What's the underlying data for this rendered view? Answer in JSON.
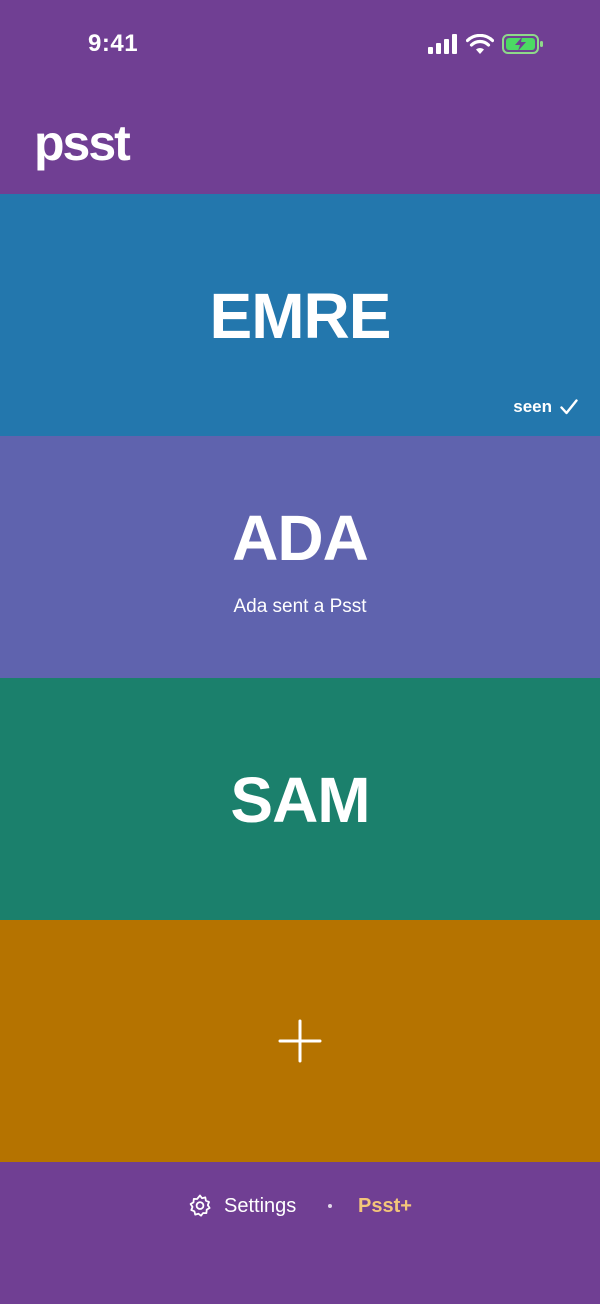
{
  "status_bar": {
    "time": "9:41",
    "icons": [
      "signal-icon",
      "wifi-icon",
      "battery-charging-icon"
    ]
  },
  "header": {
    "title": "psst"
  },
  "contacts": [
    {
      "name": "EMRE",
      "status": "seen",
      "color": "#2377ad"
    },
    {
      "name": "ADA",
      "subtitle": "Ada sent a Psst",
      "color": "#5f63ae"
    },
    {
      "name": "SAM",
      "color": "#1b806c"
    }
  ],
  "add_contact": {
    "icon": "plus-icon",
    "color": "#b57300"
  },
  "bottom_bar": {
    "settings_label": "Settings",
    "psst_plus_label": "Psst+",
    "accent": "#f3c57a"
  },
  "colors": {
    "background": "#703f93"
  }
}
